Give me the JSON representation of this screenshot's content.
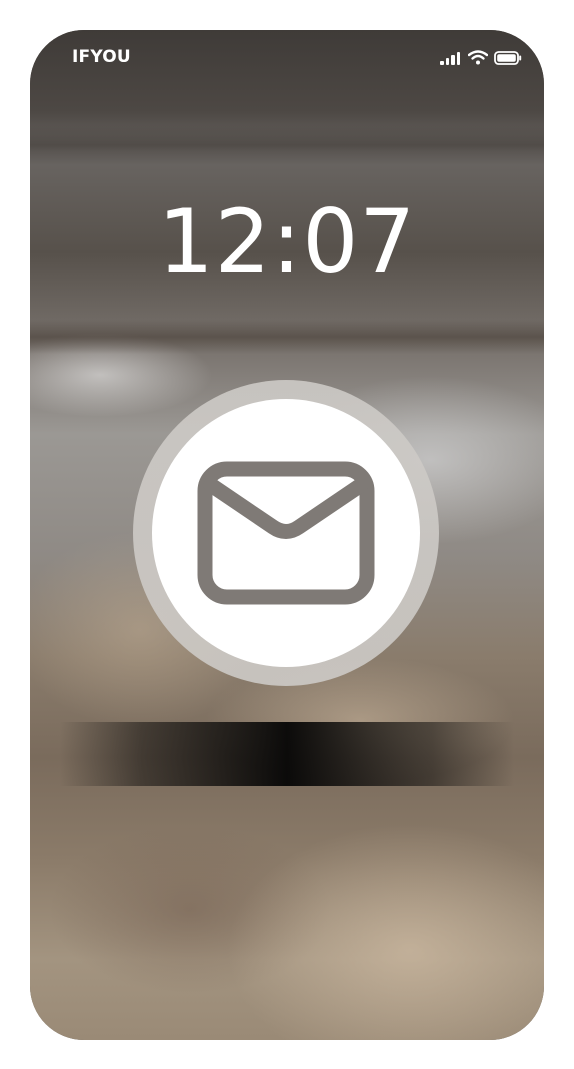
{
  "status_bar": {
    "carrier": "IFYOU",
    "signal_icon": "signal-bars-icon",
    "wifi_icon": "wifi-icon",
    "battery_icon": "battery-icon"
  },
  "lock_screen": {
    "time": "12:07",
    "notification_icon": "mail-icon"
  },
  "colors": {
    "text": "#ffffff",
    "icon_stroke": "#7f7a76",
    "button_bg": "#ffffff"
  }
}
